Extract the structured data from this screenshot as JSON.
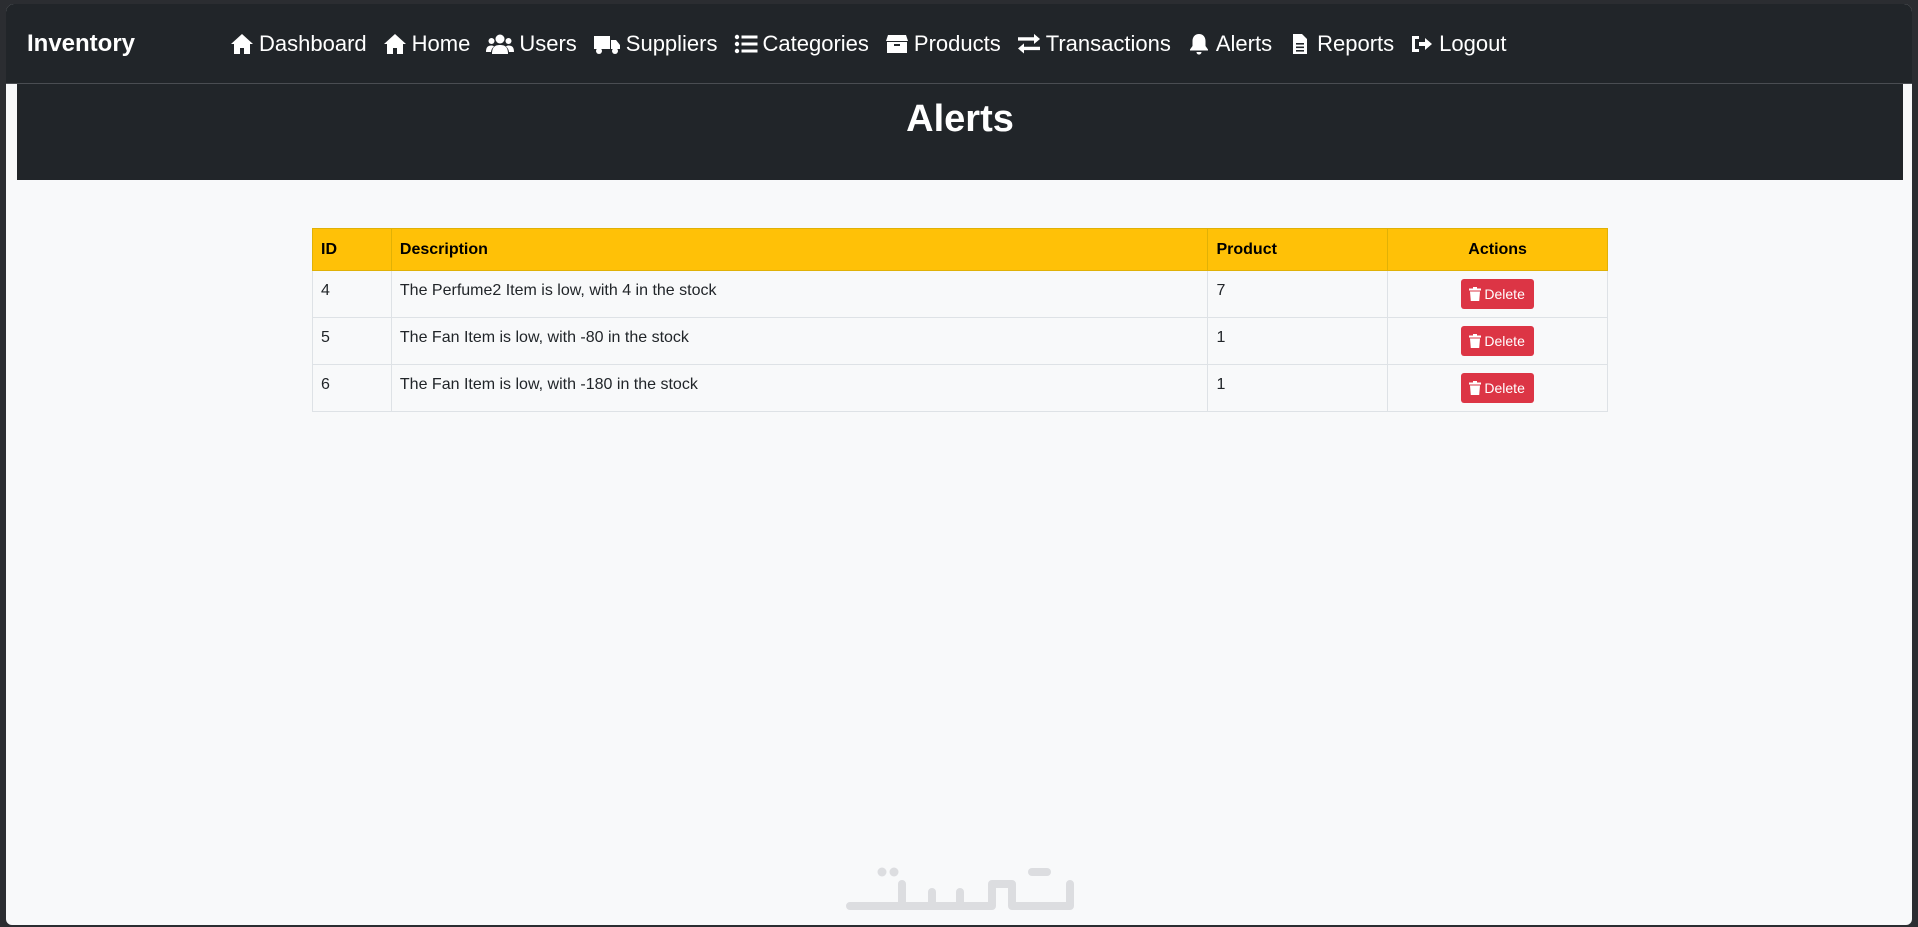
{
  "navbar": {
    "brand": "Inventory",
    "links": [
      {
        "label": "Dashboard",
        "icon": "home-icon"
      },
      {
        "label": "Home",
        "icon": "home-icon"
      },
      {
        "label": "Users",
        "icon": "users-icon"
      },
      {
        "label": "Suppliers",
        "icon": "truck-icon"
      },
      {
        "label": "Categories",
        "icon": "list-icon"
      },
      {
        "label": "Products",
        "icon": "box-icon"
      },
      {
        "label": "Transactions",
        "icon": "exchange-icon"
      },
      {
        "label": "Alerts",
        "icon": "bell-icon"
      },
      {
        "label": "Reports",
        "icon": "file-icon"
      },
      {
        "label": "Logout",
        "icon": "sign-out-icon"
      }
    ]
  },
  "page": {
    "title": "Alerts"
  },
  "table": {
    "headers": {
      "id": "ID",
      "description": "Description",
      "product": "Product",
      "actions": "Actions"
    },
    "rows": [
      {
        "id": "4",
        "description": "The Perfume2 Item is low, with 4 in the stock",
        "product": "7",
        "action_label": "Delete"
      },
      {
        "id": "5",
        "description": "The Fan Item is low, with -80 in the stock",
        "product": "1",
        "action_label": "Delete"
      },
      {
        "id": "6",
        "description": "The Fan Item is low, with -180 in the stock",
        "product": "1",
        "action_label": "Delete"
      }
    ]
  },
  "colors": {
    "navbar_bg": "#212529",
    "header_bg": "#ffc107",
    "delete_button": "#dc3545",
    "page_bg": "#f8f9fa"
  }
}
